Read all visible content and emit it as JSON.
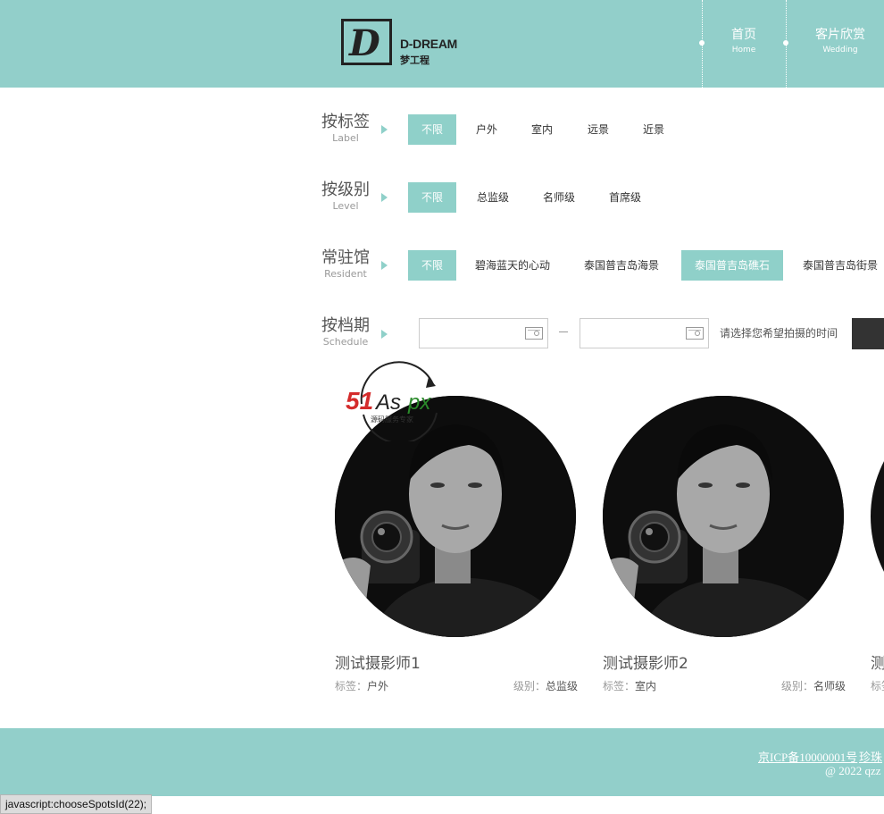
{
  "header": {
    "logo_en": "D-DREAM",
    "logo_cn": "梦工程",
    "nav": [
      {
        "cn": "首页",
        "en": "Home"
      },
      {
        "cn": "客片欣赏",
        "en": "Wedding"
      }
    ]
  },
  "filters": {
    "label": {
      "cn": "按标签",
      "en": "Label",
      "options": [
        "不限",
        "户外",
        "室内",
        "远景",
        "近景"
      ]
    },
    "level": {
      "cn": "按级别",
      "en": "Level",
      "options": [
        "不限",
        "总监级",
        "名师级",
        "首席级"
      ]
    },
    "resident": {
      "cn": "常驻馆",
      "en": "Resident",
      "options": [
        "不限",
        "碧海蓝天的心动",
        "泰国普吉岛海景",
        "泰国普吉岛礁石",
        "泰国普吉岛街景"
      ]
    },
    "schedule": {
      "cn": "按档期",
      "en": "Schedule",
      "hint": "请选择您希望拍摄的时间"
    }
  },
  "watermark": {
    "brand": "51Aspx",
    "sub": "源码服务专家"
  },
  "photographers": [
    {
      "name": "测试摄影师1",
      "tag_label": "标签：",
      "tag": "户外",
      "level_label": "级别：",
      "level": "总监级"
    },
    {
      "name": "测试摄影师2",
      "tag_label": "标签：",
      "tag": "室内",
      "level_label": "级别：",
      "level": "名师级"
    },
    {
      "name": "测",
      "tag_label": "标签",
      "tag": "",
      "level_label": "",
      "level": ""
    }
  ],
  "footer": {
    "icp": "京ICP备10000001号",
    "icp_more": "珍珠",
    "copyright": "@ 2022 qzz"
  },
  "status_bar": "javascript:chooseSpotsId(22);",
  "colors": {
    "theme": "#92cfca",
    "accent": "#8fd0c9"
  }
}
